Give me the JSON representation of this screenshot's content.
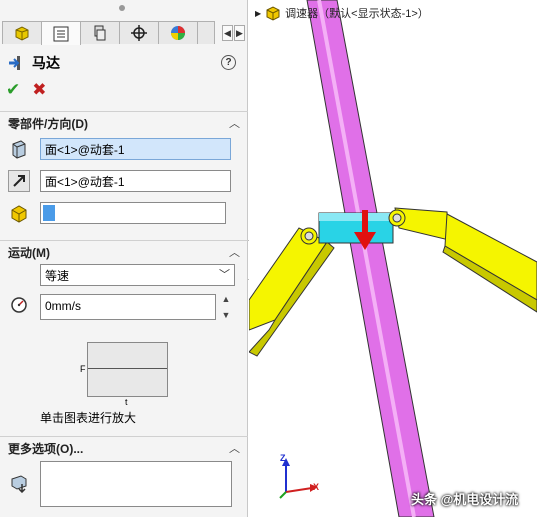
{
  "panel": {
    "tabs": [
      {
        "name": "feature-manager",
        "active": false
      },
      {
        "name": "property-manager",
        "active": true
      },
      {
        "name": "configuration-manager",
        "active": false
      },
      {
        "name": "dimxpert-manager",
        "active": false
      },
      {
        "name": "display-manager",
        "active": false
      }
    ],
    "title": "马达",
    "help_glyph": "?",
    "ok_glyph": "✔",
    "cancel_glyph": "✖",
    "section_component": {
      "title": "零部件/方向(D)",
      "location_face": "面<1>@动套-1",
      "direction_face": "面<1>@动套-1",
      "component_to_move": ""
    },
    "section_motion": {
      "title": "运动(M)",
      "motion_type": "等速",
      "speed": "0mm/s",
      "graph_y": "F",
      "graph_x": "t",
      "graph_caption": "单击图表进行放大"
    },
    "section_more": {
      "title": "更多选项(O)...",
      "list_value": ""
    }
  },
  "viewport": {
    "tree_item": "调速器（默认<显示状态-1>）",
    "axis_z": "Z",
    "axis_x": "X",
    "watermark": "头条 @机电设计流"
  },
  "colors": {
    "accent_blue": "#d2e6fb",
    "arm_yellow": "#f5f500",
    "rod_magenta": "#e070e8",
    "sleeve_cyan": "#29d3e6",
    "arrow_red": "#e01010"
  }
}
